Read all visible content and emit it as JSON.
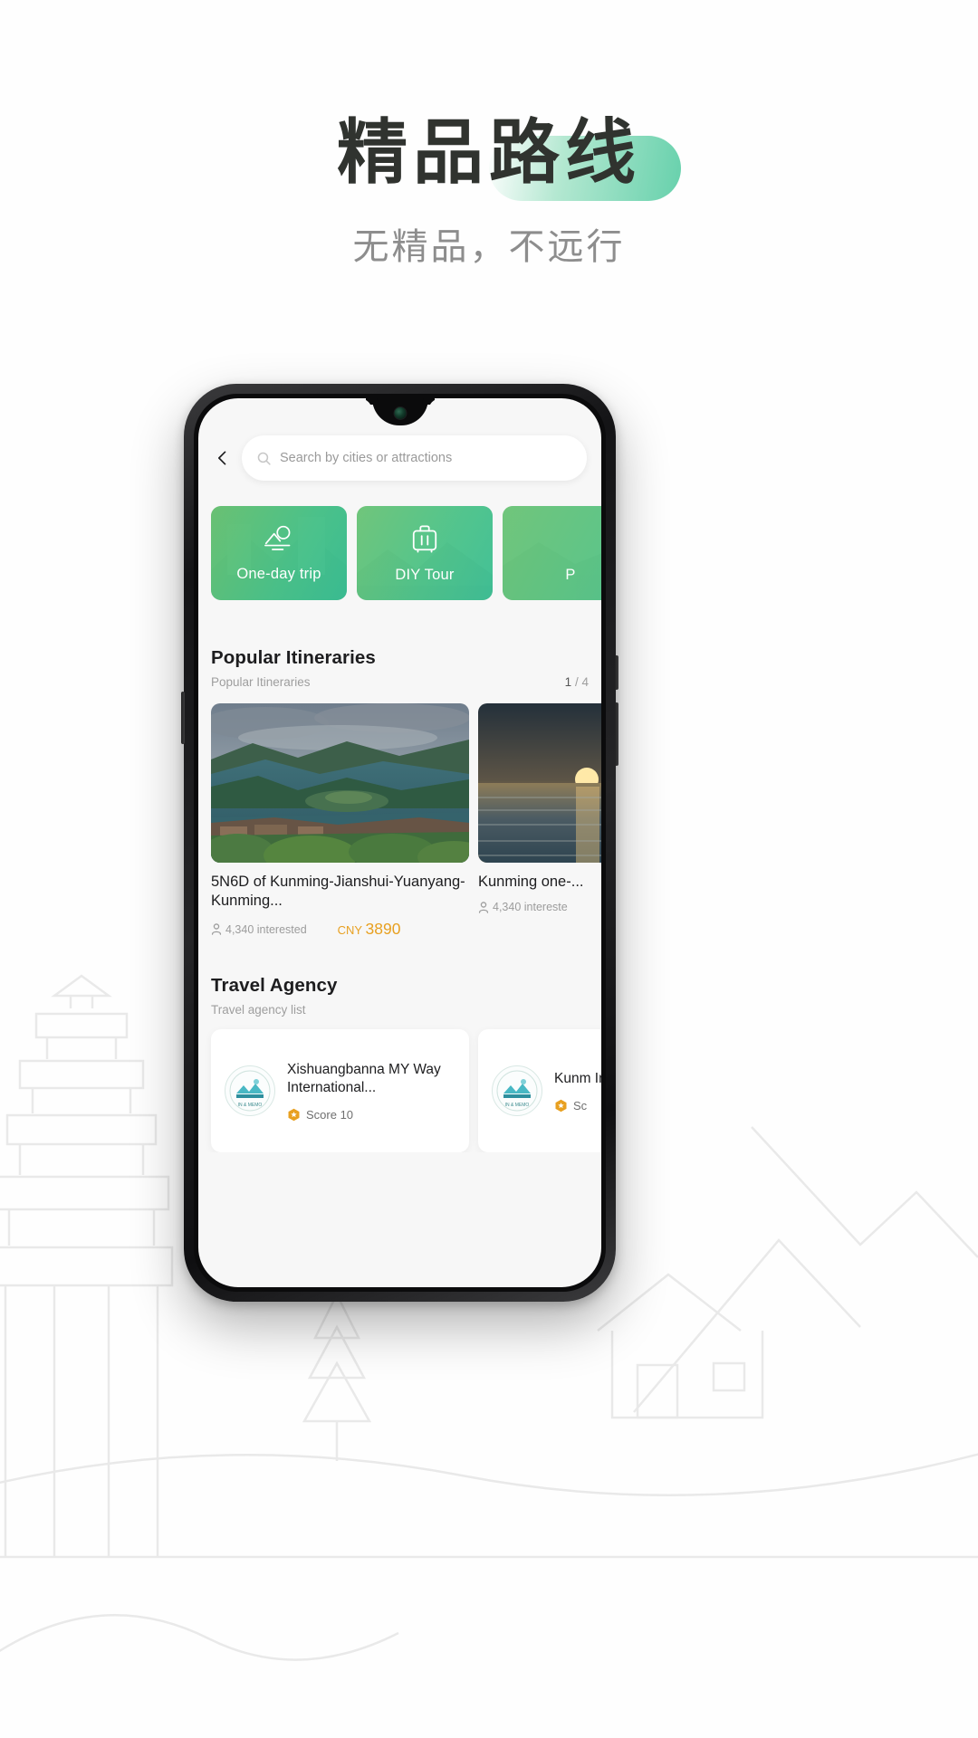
{
  "header": {
    "title": "精品路线",
    "subtitle": "无精品，不远行",
    "pill_color": "#5ACDA5"
  },
  "phone": {
    "app": {
      "topbar": {
        "back_icon": "chevron-left-icon",
        "search": {
          "icon": "search-icon",
          "placeholder": "Search by cities or attractions",
          "value": ""
        }
      },
      "categories": [
        {
          "label": "One-day trip",
          "icon": "mountain-sun-icon"
        },
        {
          "label": "DIY Tour",
          "icon": "suitcase-icon"
        },
        {
          "label": "P",
          "icon": "package-icon"
        }
      ],
      "sections": [
        {
          "title": "Popular Itineraries",
          "subtitle": "Popular Itineraries",
          "counter_current": "1",
          "counter_separator": "/",
          "counter_total": "4",
          "items": [
            {
              "title": "5N6D of Kunming-Jianshui-Yuanyang-Kunming...",
              "interested": "4,340 interested",
              "interested_icon": "person-icon",
              "currency": "CNY",
              "price": "3890"
            },
            {
              "title": "Kunming one-...",
              "interested": "4,340 intereste",
              "interested_icon": "person-icon",
              "currency": "",
              "price": ""
            }
          ]
        },
        {
          "title": "Travel Agency",
          "subtitle": "Travel agency list",
          "items": [
            {
              "name": "Xishuangbanna MY Way International...",
              "logo_icon": "agency-seal-icon",
              "score_icon": "score-badge-icon",
              "score": "Score 10"
            },
            {
              "name": "Kunm Inter",
              "logo_icon": "agency-seal-icon",
              "score_icon": "score-badge-icon",
              "score": "Sc"
            }
          ]
        }
      ]
    }
  },
  "colors": {
    "accent_green": "#3BBF7C",
    "price_orange": "#E8A020",
    "text_dark": "#1D1D1F",
    "text_muted": "#9E9E9E"
  }
}
